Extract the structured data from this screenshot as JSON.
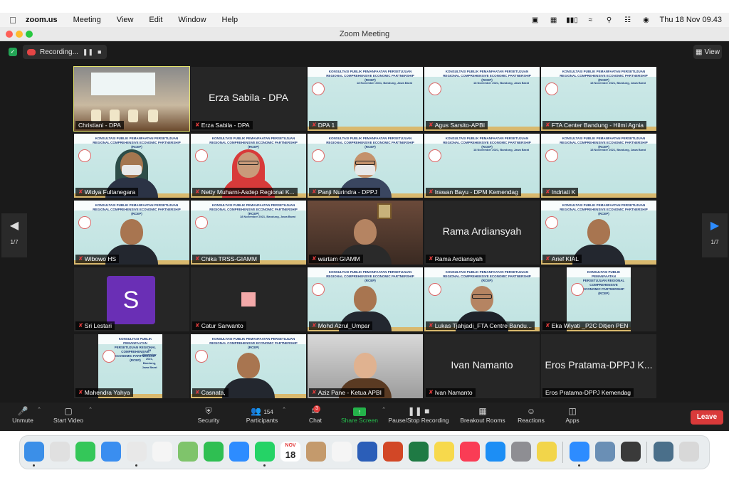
{
  "menubar": {
    "app": "zoom.us",
    "menus": [
      "Meeting",
      "View",
      "Edit",
      "Window",
      "Help"
    ],
    "clock": "Thu 18 Nov  09.43"
  },
  "window": {
    "title": "Zoom Meeting"
  },
  "recording": {
    "label": "Recording..."
  },
  "view": {
    "label": "View"
  },
  "pager": {
    "left": "1/7",
    "right": "1/7"
  },
  "slide": {
    "heading": "KONSULTASI PUBLIK PEMANFAATAN PERSETUJUAN REGIONAL COMPREHENSIVE ECONOMIC PARTNERSHIP (RCEP)",
    "date": "18 November 2021, Bandung, Jawa Barat"
  },
  "tiles": [
    {
      "name": "Christiani - DPA",
      "kind": "room",
      "muted": false
    },
    {
      "name": "Erza Sabila - DPA",
      "kind": "text",
      "big": "Erza Sabila - DPA",
      "muted": true
    },
    {
      "name": "DPA 1",
      "kind": "slide",
      "muted": true
    },
    {
      "name": "Agus Sarsito-APBI",
      "kind": "slide",
      "muted": true
    },
    {
      "name": "FTA Center Bandung - Hilmi Agnia",
      "kind": "slide",
      "muted": true
    },
    {
      "name": "Widya Fultanegara",
      "kind": "hijab",
      "muted": true
    },
    {
      "name": "Netty Muharni-Asdep Regional K...",
      "kind": "hijab-red",
      "muted": true
    },
    {
      "name": "Panji Nurindra - DPPJ",
      "kind": "masked",
      "muted": true
    },
    {
      "name": "Irawan Bayu - DPM Kemendag",
      "kind": "slide",
      "muted": true
    },
    {
      "name": "Indriati K",
      "kind": "slide",
      "muted": true
    },
    {
      "name": "Wibowo HS",
      "kind": "person-slide",
      "muted": true
    },
    {
      "name": "Chika TRSS-GIAMM",
      "kind": "slide",
      "muted": true
    },
    {
      "name": "wartam GIAMM",
      "kind": "darkroom",
      "muted": true
    },
    {
      "name": "Rama Ardiansyah",
      "kind": "text",
      "big": "Rama Ardiansyah",
      "muted": true
    },
    {
      "name": "Arief KIAL",
      "kind": "person-slide",
      "muted": true
    },
    {
      "name": "Sri Lestari",
      "kind": "avatar",
      "letter": "S",
      "muted": true
    },
    {
      "name": "Catur Sarwanto",
      "kind": "pink",
      "muted": true
    },
    {
      "name": "Mohd Azrul_Umpar",
      "kind": "person-slide",
      "muted": true
    },
    {
      "name": "Lukas Tjahjadi_FTA Centre Bandu...",
      "kind": "glasses-slide",
      "muted": true
    },
    {
      "name": "Eka Wiyati _P2C Ditjen PEN",
      "kind": "narrow-slide",
      "muted": true
    },
    {
      "name": "Mahendra Yahya",
      "kind": "narrow-slide-2",
      "muted": true
    },
    {
      "name": "Casnata,",
      "kind": "person-slide",
      "muted": true
    },
    {
      "name": "Aziz Pane - Ketua APBI",
      "kind": "elder",
      "muted": true
    },
    {
      "name": "Ivan Namanto",
      "kind": "text",
      "big": "Ivan Namanto",
      "muted": true
    },
    {
      "name": "Eros Pratama-DPPJ Kemendag",
      "kind": "text",
      "big": "Eros Pratama-DPPJ K...",
      "muted": false
    }
  ],
  "toolbar": {
    "unmute": "Unmute",
    "start_video": "Start Video",
    "security": "Security",
    "participants": "Participants",
    "participants_count": "154",
    "chat": "Chat",
    "chat_badge": "3",
    "share": "Share Screen",
    "pause_rec": "Pause/Stop Recording",
    "breakout": "Breakout Rooms",
    "reactions": "Reactions",
    "apps": "Apps",
    "leave": "Leave"
  },
  "dock": {
    "calendar_month": "NOV",
    "calendar_day": "18",
    "icons": [
      {
        "name": "finder-icon",
        "color": "#3b8fe8"
      },
      {
        "name": "launchpad-icon",
        "color": "#e0e0e0"
      },
      {
        "name": "messages-icon",
        "color": "#34c759"
      },
      {
        "name": "mail-icon",
        "color": "#3a8ef0"
      },
      {
        "name": "chrome-icon",
        "color": "#e8e8e8"
      },
      {
        "name": "photos-icon",
        "color": "#f5f5f5"
      },
      {
        "name": "maps-icon",
        "color": "#7fc46b"
      },
      {
        "name": "facetime-icon",
        "color": "#2fbf52"
      },
      {
        "name": "safari-icon",
        "color": "#2d8cff"
      },
      {
        "name": "whatsapp-icon",
        "color": "#25d366"
      },
      {
        "name": "calendar-icon",
        "color": "#ffffff"
      },
      {
        "name": "contacts-icon",
        "color": "#c49a6c"
      },
      {
        "name": "reminders-icon",
        "color": "#f5f5f5"
      },
      {
        "name": "word-icon",
        "color": "#2b5eb8"
      },
      {
        "name": "powerpoint-icon",
        "color": "#d24726"
      },
      {
        "name": "excel-icon",
        "color": "#1f7a44"
      },
      {
        "name": "notes-icon",
        "color": "#f7d94c"
      },
      {
        "name": "music-icon",
        "color": "#fa3c55"
      },
      {
        "name": "appstore-icon",
        "color": "#1c8ef5"
      },
      {
        "name": "settings-icon",
        "color": "#8e8e93"
      },
      {
        "name": "stickies-icon",
        "color": "#f2d54a"
      },
      {
        "name": "zoom-icon",
        "color": "#2d8cff"
      },
      {
        "name": "preview-icon",
        "color": "#6a8fb5"
      },
      {
        "name": "screenshot-icon",
        "color": "#3a3a3a"
      },
      {
        "name": "image-folder-icon",
        "color": "#4a6f8a"
      },
      {
        "name": "trash-icon",
        "color": "#d8d8d8"
      }
    ]
  }
}
